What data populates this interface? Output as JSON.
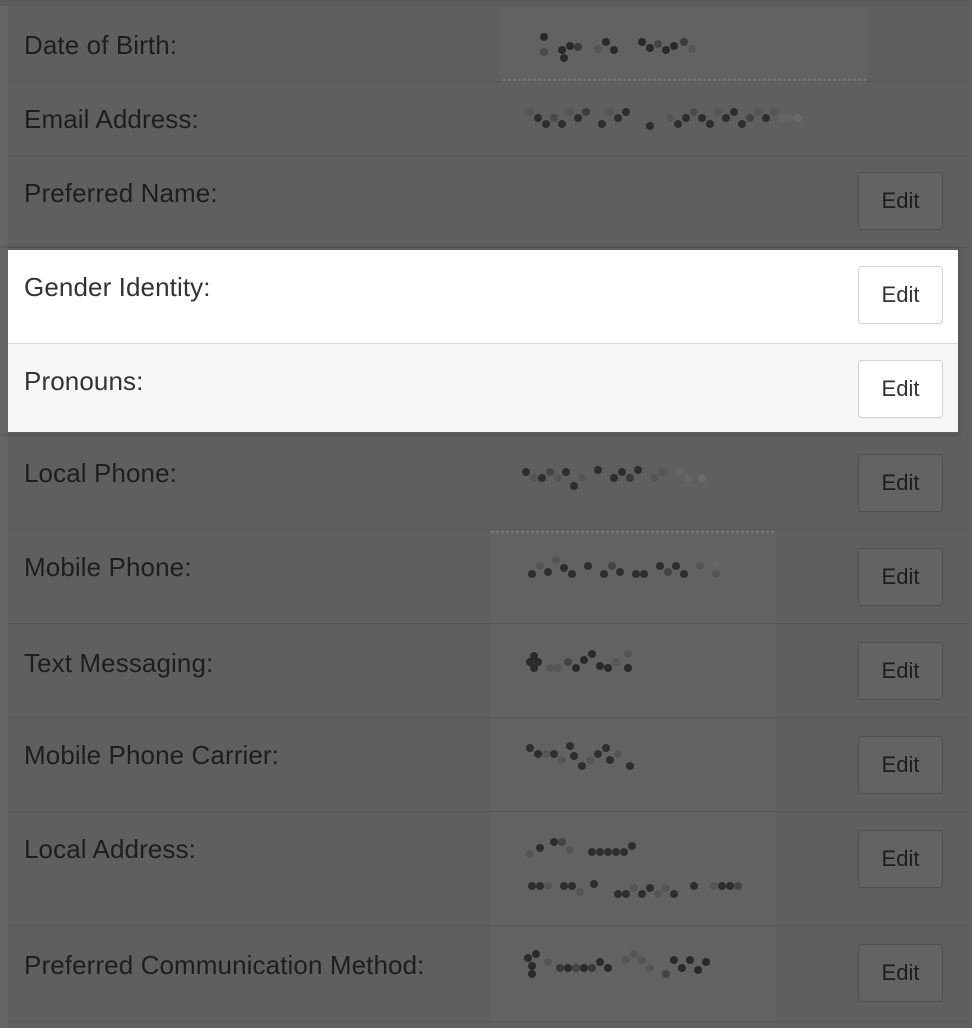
{
  "fields": [
    {
      "label": "Date of Birth:",
      "value": "",
      "edit": ""
    },
    {
      "label": "Email Address:",
      "value": "",
      "edit": ""
    },
    {
      "label": "Preferred Name:",
      "value": "",
      "edit": "Edit"
    },
    {
      "label": "Gender Identity:",
      "value": "",
      "edit": "Edit"
    },
    {
      "label": "Pronouns:",
      "value": "",
      "edit": "Edit"
    },
    {
      "label": "Local Phone:",
      "value": "",
      "edit": "Edit"
    },
    {
      "label": "Mobile Phone:",
      "value": "",
      "edit": "Edit"
    },
    {
      "label": "Text Messaging:",
      "value": "",
      "edit": "Edit"
    },
    {
      "label": "Mobile Phone Carrier:",
      "value": "",
      "edit": "Edit"
    },
    {
      "label": "Local Address:",
      "value": "",
      "edit": "Edit"
    },
    {
      "label": "Preferred Communication Method:",
      "value": "",
      "edit": "Edit"
    }
  ],
  "colors": {
    "overlay": "#656565",
    "highlight": "#ffffff",
    "highlight_alt": "#f7f7f7",
    "label_dim": "#1e1e1e",
    "label": "#333333"
  },
  "icons": {
    "redaction": "pixelated-redaction"
  }
}
